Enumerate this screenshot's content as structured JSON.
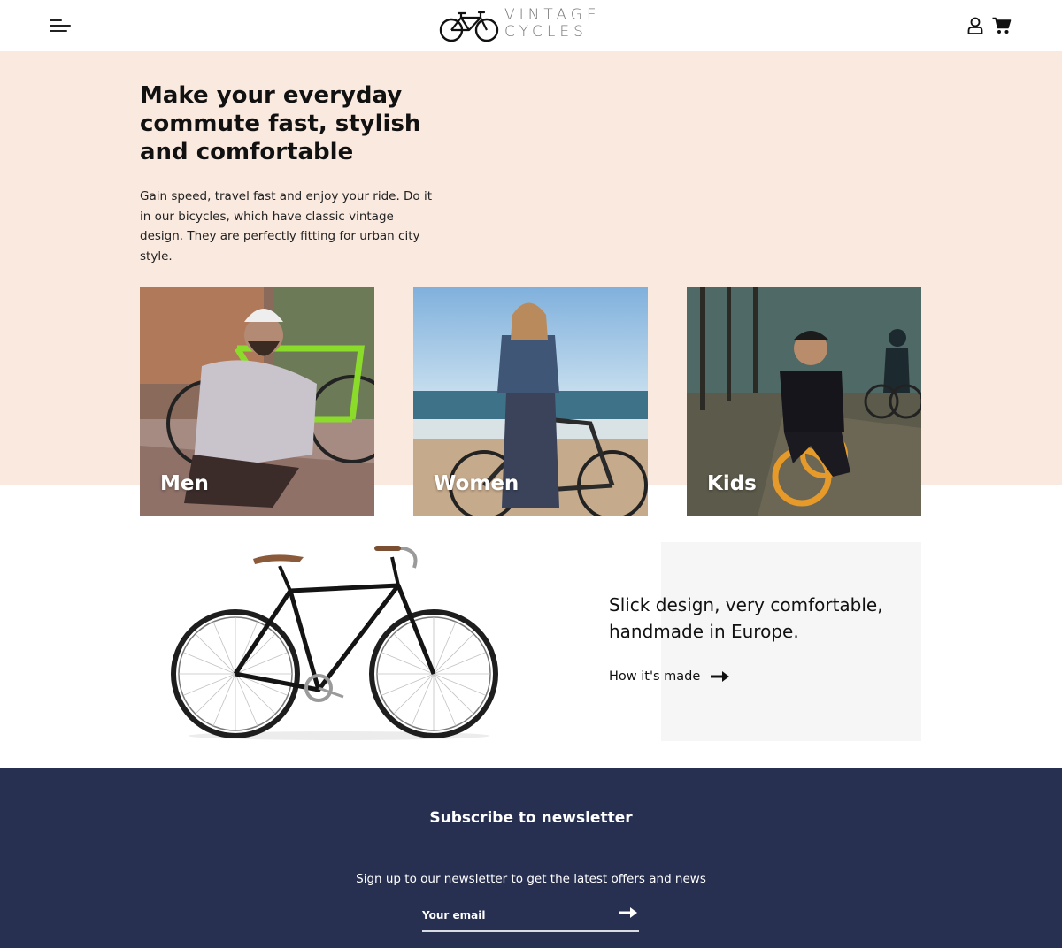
{
  "header": {
    "logo": {
      "line1": "VINTAGE",
      "line2": "CYCLES"
    },
    "menu_icon": "menu-icon",
    "user_icon": "user-icon",
    "cart_icon": "cart-icon"
  },
  "hero": {
    "title": "Make your everyday commute fast, stylish and comfortable",
    "description": "Gain speed, travel fast and enjoy your ride. Do it in our bicycles, which have classic vintage design. They are perfectly fitting for urban city style.",
    "background_color": "#fae9df"
  },
  "categories": [
    {
      "label": "Men"
    },
    {
      "label": "Women"
    },
    {
      "label": "Kids"
    }
  ],
  "promo": {
    "text": "Slick design, very comfortable, handmade in Europe.",
    "link_label": "How it's made",
    "link_icon": "arrow-right-icon"
  },
  "newsletter": {
    "title": "Subscribe to newsletter",
    "subtitle": "Sign up to our newsletter to get the latest offers and news",
    "email_placeholder": "Your email",
    "submit_icon": "arrow-right-icon",
    "background_color": "#283052"
  }
}
